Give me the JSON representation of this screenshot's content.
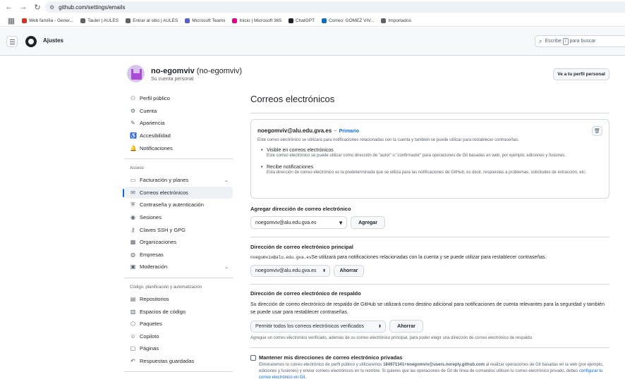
{
  "browser": {
    "url": "github.com/settings/emails",
    "bookmarks": [
      {
        "label": "Web família - Gener...",
        "color": "#d93025"
      },
      {
        "label": "Tauler | AULES",
        "color": "#5f6368"
      },
      {
        "label": "Entrar al sitio | AULES",
        "color": "#5f6368"
      },
      {
        "label": "Microsoft Teams",
        "color": "#5b5fc7"
      },
      {
        "label": "Inicio | Microsoft 365",
        "color": "#e3008c"
      },
      {
        "label": "ChatGPT",
        "color": "#202124"
      },
      {
        "label": "Correo: GÓMEZ VIV...",
        "color": "#0f6cbd"
      },
      {
        "label": "Importados",
        "color": "#5f6368"
      }
    ]
  },
  "header": {
    "title": "Ajustes",
    "search_before": "Escribe",
    "search_key": "/",
    "search_after": "para buscar"
  },
  "profile": {
    "username": "no-egomviv",
    "username_paren": "(no-egomviv)",
    "subtitle": "Su cuenta personal",
    "go_profile": "Ve a tu perfil personal"
  },
  "sidebar": {
    "top_items": [
      {
        "label": "Perfil público",
        "icon": "person-icon",
        "glyph": "⚇"
      },
      {
        "label": "Cuenta",
        "icon": "gear-icon",
        "glyph": "⚙"
      },
      {
        "label": "Apariencia",
        "icon": "paintbrush-icon",
        "glyph": "✎"
      },
      {
        "label": "Accesibilidad",
        "icon": "accessibility-icon",
        "glyph": "♿"
      },
      {
        "label": "Notificaciones",
        "icon": "bell-icon",
        "glyph": "🔔"
      }
    ],
    "access_heading": "Acceso",
    "access_items": [
      {
        "label": "Facturación y planes",
        "icon": "credit-card-icon",
        "glyph": "▭",
        "chevron": true
      },
      {
        "label": "Correos electrónicos",
        "icon": "mail-icon",
        "glyph": "✉",
        "active": true
      },
      {
        "label": "Contraseña y autenticación",
        "icon": "shield-lock-icon",
        "glyph": "⛨"
      },
      {
        "label": "Sesiones",
        "icon": "broadcast-icon",
        "glyph": "◉"
      },
      {
        "label": "Claves SSH y GPG",
        "icon": "key-icon",
        "glyph": "⚷"
      },
      {
        "label": "Organizaciones",
        "icon": "organization-icon",
        "glyph": "▦"
      },
      {
        "label": "Empresas",
        "icon": "globe-icon",
        "glyph": "◍"
      },
      {
        "label": "Moderación",
        "icon": "report-icon",
        "glyph": "▣",
        "chevron": true
      }
    ],
    "code_heading": "Código, planificación y automatización",
    "code_items": [
      {
        "label": "Repositorios",
        "icon": "repo-icon",
        "glyph": "▤"
      },
      {
        "label": "Espacios de código",
        "icon": "codespaces-icon",
        "glyph": "▥"
      },
      {
        "label": "Paquetes",
        "icon": "package-icon",
        "glyph": "⬡"
      },
      {
        "label": "Copiloto",
        "icon": "copilot-icon",
        "glyph": "☺"
      },
      {
        "label": "Páginas",
        "icon": "browser-icon",
        "glyph": "▢"
      },
      {
        "label": "Respuestas guardadas",
        "icon": "reply-icon",
        "glyph": "↶"
      }
    ],
    "security_heading": "Seguridad"
  },
  "main": {
    "title": "Correos electrónicos",
    "primary_email": {
      "address": "noegomviv@alu.edu.gva.es",
      "dash": "–",
      "badge": "Primario",
      "description": "Este correo electrónico se utilizará para notificaciones relacionadas con la cuenta y también se puede utilizar para restablecer contraseñas.",
      "bullets": [
        {
          "title": "Visible en correos electrónicos",
          "text": "Este correo electrónico se puede utilizar como dirección de \"autor\" o \"confirmador\" para operaciones de Git basadas en web, por ejemplo, ediciones y fusiones."
        },
        {
          "title": "Recibe notificaciones",
          "text": "Esta dirección de correo electrónico es la predeterminada que se utiliza para las notificaciones de GitHub, es decir, respuestas a problemas, solicitudes de extracción, etc."
        }
      ]
    },
    "add_email": {
      "title": "Agregar dirección de correo electrónico",
      "value": "noegomviv@alu.edu.gva.es",
      "button": "Agregar"
    },
    "primary_section": {
      "title": "Dirección de correo electrónico principal",
      "mono": "noegomviv@alu.edu.gva.es",
      "text": "Se utilizará para notificaciones relacionadas con la cuenta y se puede utilizar para restablecer contraseñas.",
      "select_value": "noegomviv@alu.edu.gva.es",
      "button": "Ahorrar"
    },
    "backup_section": {
      "title": "Dirección de correo electrónico de respaldo",
      "text": "Su dirección de correo electrónico de respaldo de GitHub se utilizará como destino adicional para notificaciones de cuenta relevantes para la seguridad y también se puede usar para restablecer contraseñas.",
      "select_value": "Permitir todos los correos electrónicos verificados",
      "button": "Ahorrar",
      "note": "Agregue un correo electrónico verificado, además de su correo electrónico principal, para poder elegir una dirección de correo electrónico de respaldo."
    },
    "private_section": {
      "title": "Mantener mis direcciones de correo electrónico privadas",
      "text_before": "Eliminaremos tu correo electrónico de perfil público y utilizaremos ",
      "noreply": "184971341+noegomviv@users.noreply.github.com",
      "text_after": " al realizar operaciones de Git basadas en la web (por ejemplo, ediciones y fusiones) y enviar correos electrónicos en tu nombre. Si quieres que las operaciones de Git de línea de comandos utilicen tu correo electrónico privado, debes ",
      "link": "configurar tu correo electrónico en Git",
      "end": "."
    }
  }
}
